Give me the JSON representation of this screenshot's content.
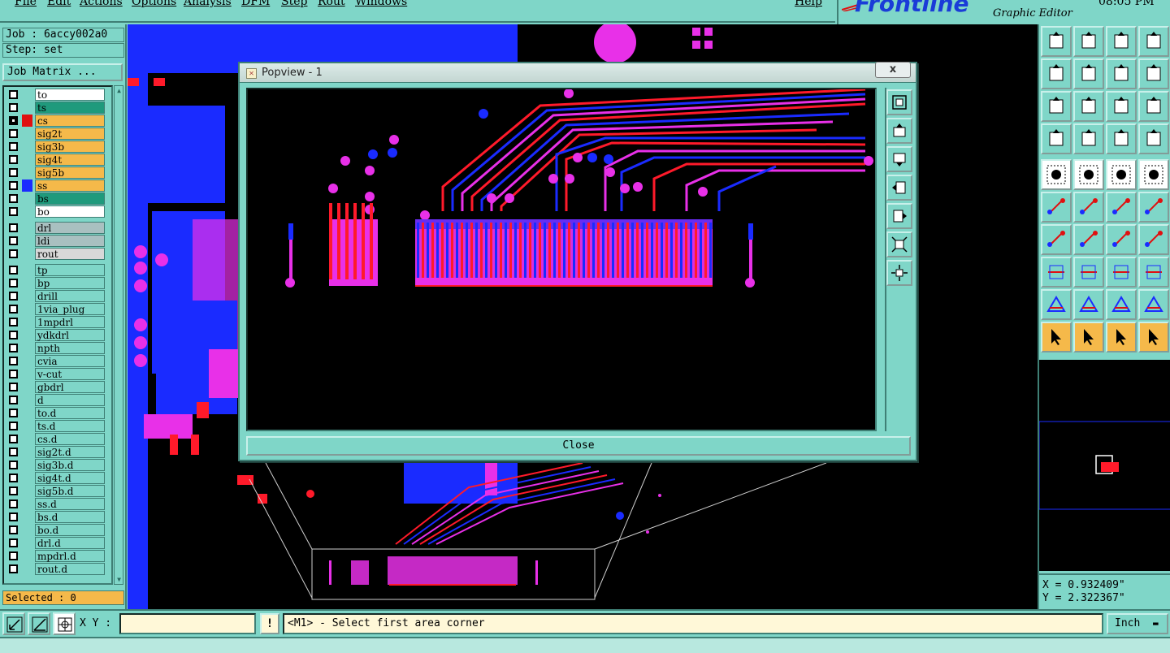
{
  "menu": {
    "items": [
      "File",
      "Edit",
      "Actions",
      "Options",
      "Analysis",
      "DFM",
      "Step",
      "Rout",
      "Windows"
    ],
    "help": "Help"
  },
  "branding": {
    "logo": "Frontline",
    "subtitle": "Graphic Editor",
    "clock": "08:05 PM"
  },
  "job": {
    "job_line": "Job : 6accy002a0",
    "step_line": "Step: set",
    "matrix_button": "Job Matrix ..."
  },
  "layers": [
    {
      "name": "to",
      "bg": "#ffffff",
      "color": ""
    },
    {
      "name": "ts",
      "bg": "#1f9a7c",
      "color": ""
    },
    {
      "name": "cs",
      "bg": "#f5b94a",
      "color": "#e01010",
      "selected": true
    },
    {
      "name": "sig2t",
      "bg": "#f5b94a",
      "color": ""
    },
    {
      "name": "sig3b",
      "bg": "#f5b94a",
      "color": ""
    },
    {
      "name": "sig4t",
      "bg": "#f5b94a",
      "color": ""
    },
    {
      "name": "sig5b",
      "bg": "#f5b94a",
      "color": ""
    },
    {
      "name": "ss",
      "bg": "#f5b94a",
      "color": "#1a2bff"
    },
    {
      "name": "bs",
      "bg": "#1f9a7c",
      "color": ""
    },
    {
      "name": "bo",
      "bg": "#ffffff",
      "color": ""
    },
    {
      "name": "drl",
      "bg": "#a9c0c0",
      "color": ""
    },
    {
      "name": "ldi",
      "bg": "#a9c0c0",
      "color": ""
    },
    {
      "name": "rout",
      "bg": "#d8d8d8",
      "color": ""
    },
    {
      "name": "tp",
      "bg": "#7fd6c8",
      "color": ""
    },
    {
      "name": "bp",
      "bg": "#7fd6c8",
      "color": ""
    },
    {
      "name": "drill",
      "bg": "#7fd6c8",
      "color": ""
    },
    {
      "name": "1via_plug",
      "bg": "#7fd6c8",
      "color": ""
    },
    {
      "name": "1mpdrl",
      "bg": "#7fd6c8",
      "color": ""
    },
    {
      "name": "ydkdrl",
      "bg": "#7fd6c8",
      "color": ""
    },
    {
      "name": "npth",
      "bg": "#7fd6c8",
      "color": ""
    },
    {
      "name": "cvia",
      "bg": "#7fd6c8",
      "color": ""
    },
    {
      "name": "v-cut",
      "bg": "#7fd6c8",
      "color": ""
    },
    {
      "name": "gbdrl",
      "bg": "#7fd6c8",
      "color": ""
    },
    {
      "name": "d",
      "bg": "#7fd6c8",
      "color": ""
    },
    {
      "name": "to.d",
      "bg": "#7fd6c8",
      "color": ""
    },
    {
      "name": "ts.d",
      "bg": "#7fd6c8",
      "color": ""
    },
    {
      "name": "cs.d",
      "bg": "#7fd6c8",
      "color": ""
    },
    {
      "name": "sig2t.d",
      "bg": "#7fd6c8",
      "color": ""
    },
    {
      "name": "sig3b.d",
      "bg": "#7fd6c8",
      "color": ""
    },
    {
      "name": "sig4t.d",
      "bg": "#7fd6c8",
      "color": ""
    },
    {
      "name": "sig5b.d",
      "bg": "#7fd6c8",
      "color": ""
    },
    {
      "name": "ss.d",
      "bg": "#7fd6c8",
      "color": ""
    },
    {
      "name": "bs.d",
      "bg": "#7fd6c8",
      "color": ""
    },
    {
      "name": "bo.d",
      "bg": "#7fd6c8",
      "color": ""
    },
    {
      "name": "drl.d",
      "bg": "#7fd6c8",
      "color": ""
    },
    {
      "name": "mpdrl.d",
      "bg": "#7fd6c8",
      "color": ""
    },
    {
      "name": "rout.d",
      "bg": "#7fd6c8",
      "color": ""
    }
  ],
  "selected_text": "Selected : 0",
  "popview": {
    "title": "Popview - 1",
    "close_x": "x",
    "close_button": "Close"
  },
  "coords": {
    "x": "X = 0.932409\"",
    "y": "Y = 2.322367\""
  },
  "status": {
    "xy_label": "X Y :",
    "xy_value": "",
    "exclaim": "!",
    "prompt": "<M1> - Select first area corner",
    "units": "Inch"
  },
  "colors": {
    "top_layer": "#ff1a2a",
    "bottom_layer": "#1a2bff",
    "overlap": "#e830e8",
    "background": "#000000",
    "panel": "#7fd6c8"
  }
}
